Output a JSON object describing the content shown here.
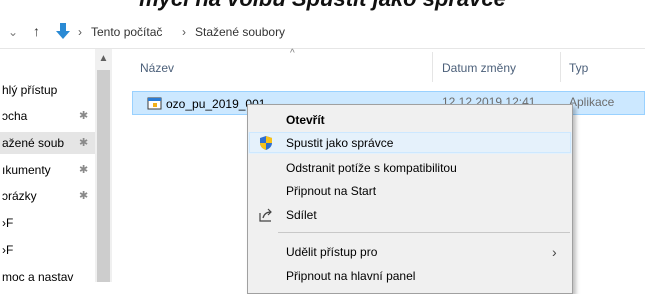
{
  "caption": "myčí na volbu Spustit jako správce",
  "address_bar": {
    "back_arrow": "⌄",
    "up_arrow": "↑",
    "folder_icon": "download-folder-icon",
    "sep1": "›",
    "crumb1": "Tento počítač",
    "sep2": "›",
    "crumb2": "Stažené soubory"
  },
  "nav": {
    "items": [
      {
        "label": "hlý přístup",
        "pinned": false
      },
      {
        "label": "ɔcha",
        "pinned": true
      },
      {
        "label": "ažené soub",
        "pinned": true
      },
      {
        "label": "ıkumenty",
        "pinned": true
      },
      {
        "label": "ɔrázky",
        "pinned": true
      },
      {
        "label": "›F",
        "pinned": false
      },
      {
        "label": "›F",
        "pinned": false
      },
      {
        "label": "moc a nastav",
        "pinned": false
      }
    ],
    "pin_glyph": "📌"
  },
  "columns": {
    "name": "Název",
    "date": "Datum změny",
    "type": "Typ"
  },
  "file": {
    "name": "ozo_pu_2019_001",
    "date": "12.12.2019 12:41",
    "type": "Aplikace"
  },
  "context_menu": {
    "items": [
      {
        "label": "Otevřít",
        "bold": true
      },
      {
        "label": "Spustit jako správce",
        "icon": "uac-shield-icon",
        "highlighted": true
      },
      {
        "label": "Odstranit potíže s kompatibilitou"
      },
      {
        "label": "Připnout na Start"
      },
      {
        "label": "Sdílet",
        "icon": "share-icon"
      },
      {
        "label": "Udělit přístup pro",
        "submenu": true
      },
      {
        "label": "Připnout na hlavní panel"
      }
    ],
    "submenu_glyph": "›"
  },
  "colors": {
    "selection": "#cce8ff",
    "menu_bg": "#f0f0f0",
    "menu_highlight": "#e5f1fb",
    "folder_blue": "#2a8ad4",
    "shield_blue": "#2f6fd0",
    "shield_yellow": "#f7c21a"
  }
}
